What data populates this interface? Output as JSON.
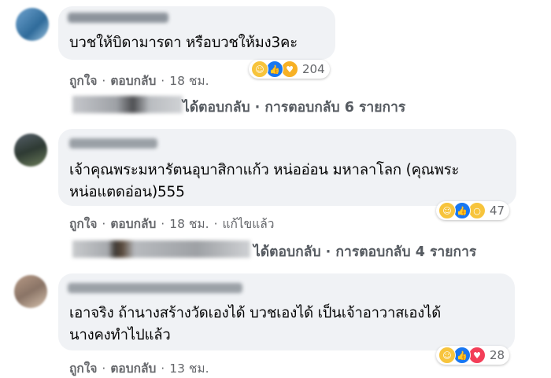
{
  "comments": [
    {
      "text_lines": [
        "บวชให้บิดามารดา หรือบวชให้มง3คะ"
      ],
      "actions": {
        "like": "ถูกใจ",
        "reply": "ตอบกลับ",
        "time": "18 ชม.",
        "edited": ""
      },
      "reactions": {
        "icons": [
          "haha-icon",
          "like-icon",
          "care-icon"
        ],
        "count": "204"
      },
      "replies_summary": "ได้ตอบกลับ · การตอบกลับ 6 รายการ"
    },
    {
      "text_lines": [
        "เจ้าคุณพระมหารัตนอุบาสิกาแก้ว หน่ออ่อน มหาลาโลก (คุณพระ",
        "หน่อแตดอ่อน)555"
      ],
      "actions": {
        "like": "ถูกใจ",
        "reply": "ตอบกลับ",
        "time": "18 ชม.",
        "edited": "แก้ไขแล้ว"
      },
      "reactions": {
        "icons": [
          "haha-icon",
          "like-icon",
          "wow-icon"
        ],
        "count": "47"
      },
      "replies_summary": "ได้ตอบกลับ · การตอบกลับ 4 รายการ"
    },
    {
      "text_lines": [
        "เอาจริง ถ้านางสร้างวัดเองได้ บวชเองได้ เป็นเจ้าอาวาสเองได้",
        "นางคงทำไปแล้ว"
      ],
      "actions": {
        "like": "ถูกใจ",
        "reply": "ตอบกลับ",
        "time": "13 ชม.",
        "edited": ""
      },
      "reactions": {
        "icons": [
          "haha-icon",
          "like-icon",
          "love-icon"
        ],
        "count": "28"
      },
      "replies_summary": ""
    }
  ],
  "colors": {
    "bubble": "#f0f2f5",
    "meta": "#65676b",
    "reaction_like": "#1877f2",
    "reaction_haha": "#f7c43c",
    "reaction_love": "#f33e58"
  }
}
